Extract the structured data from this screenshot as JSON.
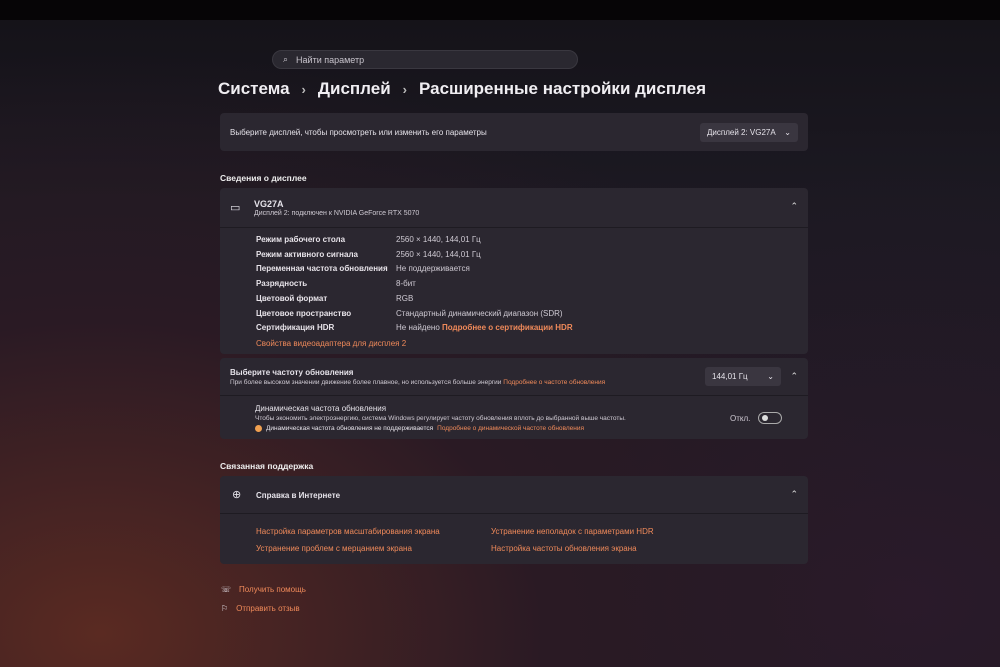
{
  "search": {
    "placeholder": "Найти параметр",
    "icon": "search-icon"
  },
  "breadcrumb": [
    "Система",
    "Дисплей",
    "Расширенные настройки дисплея"
  ],
  "select_display": {
    "label": "Выберите дисплей, чтобы просмотреть или изменить его параметры",
    "value": "Дисплей 2: VG27A"
  },
  "display_info": {
    "heading": "Сведения о дисплее",
    "name": "VG27A",
    "subtitle": "Дисплей 2: подключен к NVIDIA GeForce RTX 5070",
    "rows": [
      {
        "k": "Режим рабочего стола",
        "v": "2560 × 1440, 144,01 Гц"
      },
      {
        "k": "Режим активного сигнала",
        "v": "2560 × 1440, 144,01 Гц"
      },
      {
        "k": "Переменная частота обновления",
        "v": "Не поддерживается"
      },
      {
        "k": "Разрядность",
        "v": "8-бит"
      },
      {
        "k": "Цветовой формат",
        "v": "RGB"
      },
      {
        "k": "Цветовое пространство",
        "v": "Стандартный динамический диапазон (SDR)"
      },
      {
        "k": "Сертификация HDR",
        "v": "Не найдено",
        "link": "Подробнее о сертификации HDR"
      }
    ],
    "adapter_link": "Свойства видеоадаптера для дисплея 2"
  },
  "refresh": {
    "title": "Выберите частоту обновления",
    "desc": "При более высоком значении движение более плавное, но используется больше энергии",
    "link": "Подробнее о частоте обновления",
    "value": "144,01 Гц",
    "dynamic": {
      "title": "Динамическая частота обновления",
      "desc": "Чтобы экономить электроэнергию, система Windows регулирует частоту обновления вплоть до выбранной выше частоты.",
      "warning": "Динамическая частота обновления не поддерживается",
      "link": "Подробнее о динамической частоте обновления",
      "toggle_label": "Откл.",
      "toggle_on": false
    }
  },
  "support": {
    "heading": "Связанная поддержка",
    "title": "Справка в Интернете",
    "links": [
      "Настройка параметров масштабирования экрана",
      "Устранение неполадок с параметрами HDR",
      "Устранение проблем с мерцанием экрана",
      "Настройка частоты обновления экрана"
    ]
  },
  "footer": {
    "help": "Получить помощь",
    "feedback": "Отправить отзыв"
  },
  "colors": {
    "accent": "#f08a5a"
  }
}
